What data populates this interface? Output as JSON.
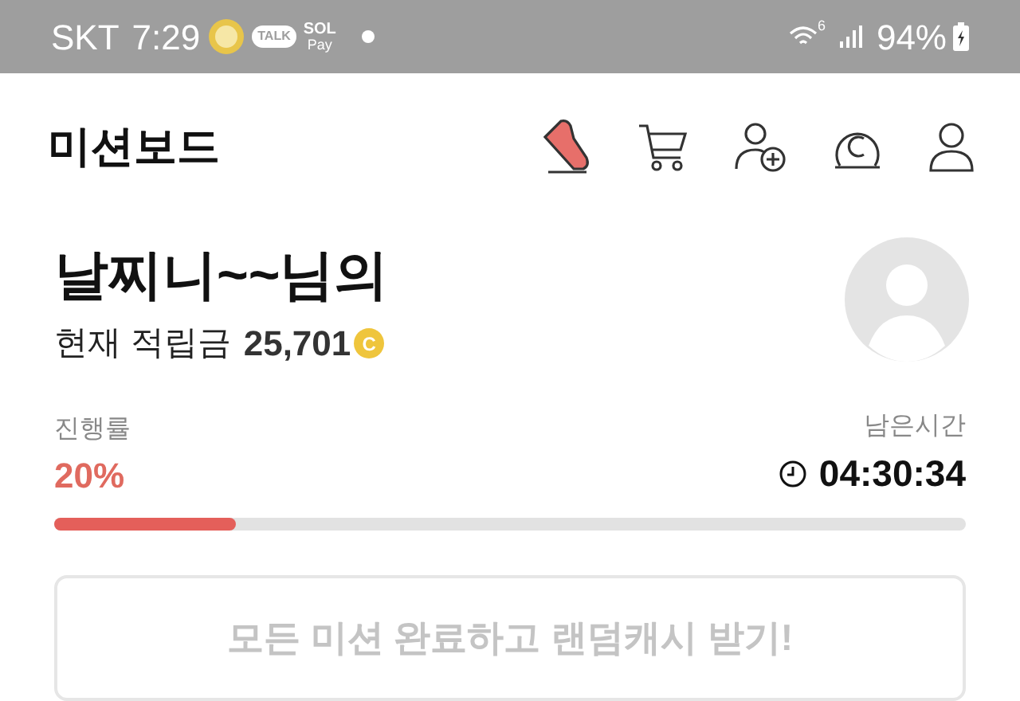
{
  "status_bar": {
    "carrier": "SKT",
    "time": "7:29",
    "talk_label": "TALK",
    "pay_top": "SOL",
    "pay_bottom": "Pay",
    "wifi_badge": "6",
    "battery": "94%"
  },
  "header": {
    "title": "미션보드"
  },
  "profile": {
    "name": "날찌니~~님의",
    "points_label": "현재 적립금",
    "points": "25,701",
    "coin": "C"
  },
  "progress": {
    "label": "진행률",
    "value": "20%",
    "level": 0.2
  },
  "timer": {
    "label": "남은시간",
    "value": "04:30:34"
  },
  "reward_button": {
    "label": "모든 미션 완료하고 랜덤캐시 받기!",
    "disabled": true
  }
}
